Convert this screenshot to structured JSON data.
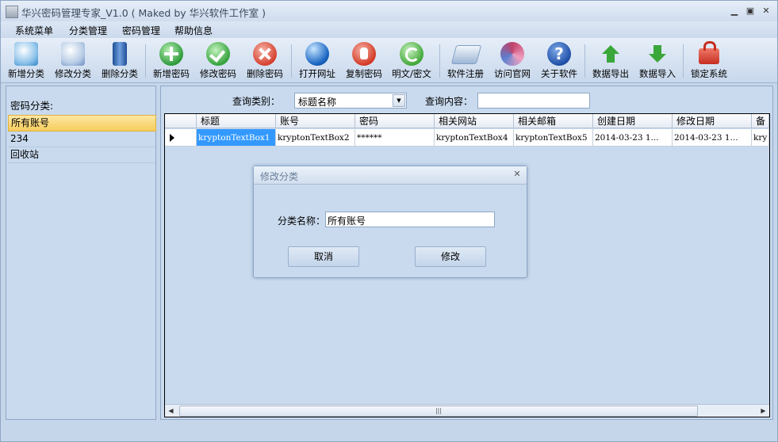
{
  "window": {
    "title": "华兴密码管理专家_V1.0 ( Maked by 华兴软件工作室 )",
    "controls": [
      "minimize",
      "restore",
      "close"
    ]
  },
  "menu": {
    "items": [
      {
        "label": "系统菜单"
      },
      {
        "label": "分类管理"
      },
      {
        "label": "密码管理"
      },
      {
        "label": "帮助信息"
      }
    ]
  },
  "toolbar": {
    "buttons": [
      {
        "label": "新增分类",
        "icon": "pencil-doc-icon",
        "color": "#2f86c8"
      },
      {
        "label": "修改分类",
        "icon": "pencil-icon",
        "color": "#6a8dc0"
      },
      {
        "label": "删除分类",
        "icon": "trash-icon",
        "color": "#2b5fae"
      },
      {
        "label": "新增密码",
        "icon": "plus-circle-icon",
        "color": "#2e9b3a"
      },
      {
        "label": "修改密码",
        "icon": "check-circle-icon",
        "color": "#35a23c"
      },
      {
        "label": "删除密码",
        "icon": "x-circle-icon",
        "color": "#d6412f"
      },
      {
        "label": "打开网址",
        "icon": "globe-icon",
        "color": "#1c67c4"
      },
      {
        "label": "复制密码",
        "icon": "hand-icon",
        "color": "#d33a25"
      },
      {
        "label": "明文/密文",
        "icon": "refresh-icon",
        "color": "#43a83a"
      },
      {
        "label": "软件注册",
        "icon": "keyboard-icon",
        "color": "#7f9ec6"
      },
      {
        "label": "访问官网",
        "icon": "network-icon",
        "color": "#c0426a"
      },
      {
        "label": "关于软件",
        "icon": "help-icon",
        "color": "#1f4fa8"
      },
      {
        "label": "数据导出",
        "icon": "arrow-up-icon",
        "color": "#3aa73a"
      },
      {
        "label": "数据导入",
        "icon": "arrow-down-icon",
        "color": "#3aa73a"
      },
      {
        "label": "锁定系统",
        "icon": "lock-icon",
        "color": "#d63a2c"
      }
    ]
  },
  "sidebar": {
    "title": "密码分类:",
    "items": [
      {
        "label": "所有账号",
        "selected": true
      },
      {
        "label": "234",
        "selected": false
      },
      {
        "label": "回收站",
        "selected": false
      }
    ]
  },
  "query": {
    "type_label": "查询类别：",
    "type_value": "标题名称",
    "content_label": "查询内容：",
    "content_value": ""
  },
  "table": {
    "columns": [
      "标题",
      "账号",
      "密码",
      "相关网站",
      "相关邮箱",
      "创建日期",
      "修改日期",
      "备注"
    ],
    "rows": [
      [
        "kryptonTextBox1",
        "kryptonTextBox2",
        "******",
        "kryptonTextBox4",
        "kryptonTextBox5",
        "2014-03-23 1...",
        "2014-03-23 1...",
        "kry"
      ]
    ]
  },
  "dialog": {
    "title": "修改分类",
    "field_label": "分类名称：",
    "field_value": "所有账号",
    "cancel_label": "取消",
    "confirm_label": "修改"
  }
}
